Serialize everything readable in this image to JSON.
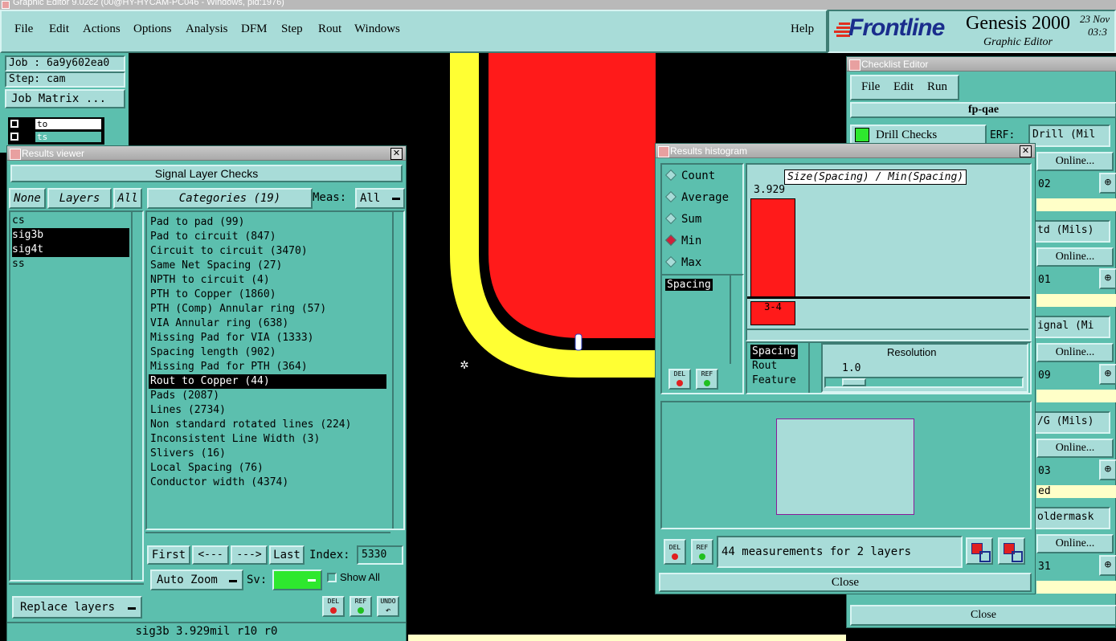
{
  "window_title": "Graphic Editor 9.02c2 (00@HY-HYCAM-PC046 - Windows, pid:1976)",
  "menu": [
    "File",
    "Edit",
    "Actions",
    "Options",
    "Analysis",
    "DFM",
    "Step",
    "Rout",
    "Windows"
  ],
  "help_label": "Help",
  "brand": {
    "logo": "Frontline",
    "product": "Genesis 2000",
    "subtitle": "Graphic Editor",
    "date": "23 Nov",
    "time": "03:3"
  },
  "job_panel": {
    "job": "Job : 6a9y602ea0",
    "step": "Step: cam",
    "job_matrix": "Job Matrix ...",
    "layer_rows": [
      "to",
      "ts"
    ]
  },
  "results_viewer": {
    "title": "Results viewer",
    "section": "Signal Layer Checks",
    "none": "None",
    "layers": "Layers",
    "all": "All",
    "categories_btn": "Categories (19)",
    "meas_label": "Meas:",
    "meas_value": "All",
    "layer_list": [
      "cs",
      "sig3b",
      "sig4t",
      "ss"
    ],
    "selected_layers": [
      "sig3b",
      "sig4t"
    ],
    "categories": [
      "Pad to pad (99)",
      "Pad to circuit (847)",
      "Circuit to circuit (3470)",
      "Same Net Spacing (27)",
      "NPTH to circuit (4)",
      "PTH to Copper (1860)",
      "PTH (Comp) Annular ring (57)",
      "VIA Annular ring (638)",
      "Missing Pad for VIA (1333)",
      "Spacing length (902)",
      "Missing Pad for PTH (364)",
      "Rout to Copper (44)",
      "Pads (2087)",
      "Lines (2734)",
      "Non standard rotated lines (224)",
      "Inconsistent Line Width (3)",
      "Slivers (16)",
      "Local Spacing (76)",
      "Conductor width (4374)"
    ],
    "selected_category": "Rout to Copper (44)",
    "nav": {
      "first": "First",
      "prev": "<---",
      "next": "--->",
      "last": "Last",
      "index_label": "Index:",
      "index_value": "5330"
    },
    "auto_zoom": "Auto Zoom",
    "sv_label": "Sv:",
    "show_all": "Show All",
    "replace_layers": "Replace layers",
    "del": "DEL",
    "ref": "REF",
    "undo": "UNDO",
    "status": "sig3b 3.929mil  r10  r0"
  },
  "histogram": {
    "title": "Results histogram",
    "modes": [
      "Count",
      "Average",
      "Sum",
      "Min",
      "Max"
    ],
    "selected_mode": "Min",
    "chart_title": "Size(Spacing) / Min(Spacing)",
    "bar_value": "3.929",
    "bar_label": "3-4",
    "measure_list": [
      "Spacing"
    ],
    "attr_list": [
      "Spacing",
      "Rout",
      "Feature"
    ],
    "resolution_label": "Resolution",
    "resolution_value": "1.0",
    "summary": "44 measurements for 2 layers",
    "close": "Close",
    "del": "DEL",
    "ref": "REF"
  },
  "checklist": {
    "title": "Checklist Editor",
    "menu": [
      "File",
      "Edit",
      "Run"
    ],
    "name": "fp-qae",
    "drill_checks": "Drill Checks",
    "erf": "ERF:",
    "erf_items": [
      "Drill (Mil",
      "td (Mils)",
      "ignal (Mi",
      "/G (Mils)",
      "oldermask"
    ],
    "online": "Online...",
    "row_nums": [
      "02",
      "01",
      "09",
      "03",
      "31"
    ],
    "status_ed": "ed",
    "close": "Close"
  }
}
